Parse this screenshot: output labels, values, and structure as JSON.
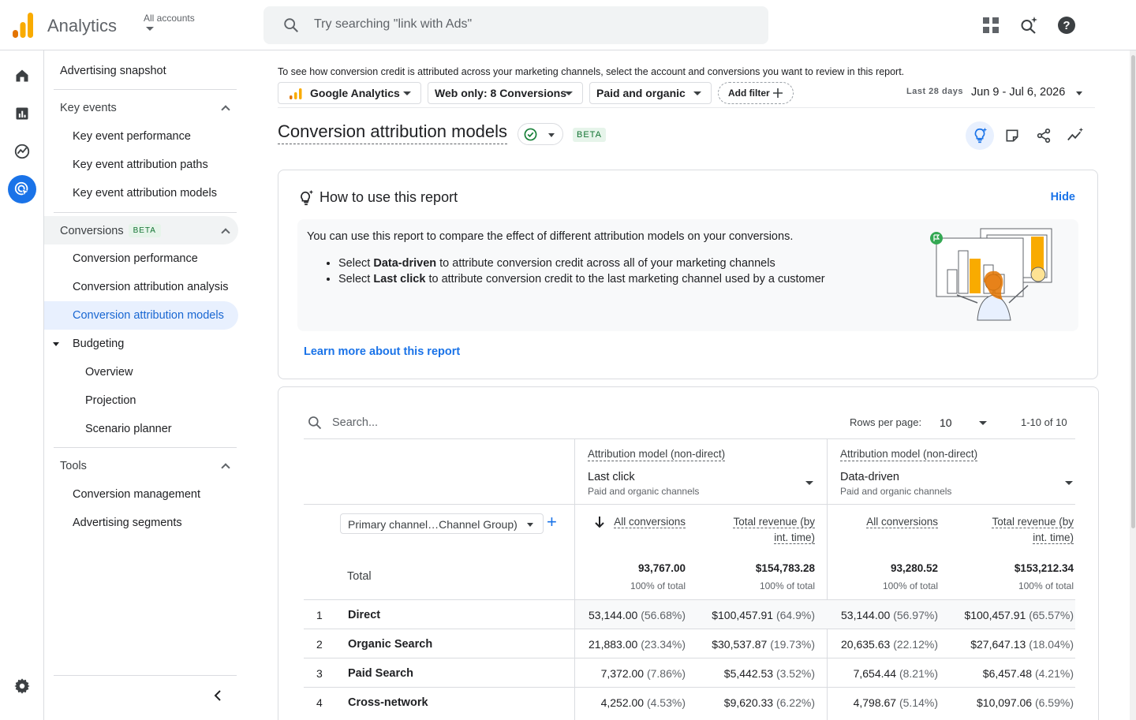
{
  "app": {
    "title": "Analytics",
    "account_label": "All accounts",
    "search_placeholder": "Try searching \"link with Ads\""
  },
  "sidebar": {
    "advertising_snapshot": "Advertising snapshot",
    "key_events": {
      "label": "Key events",
      "items": [
        "Key event performance",
        "Key event attribution paths",
        "Key event attribution models"
      ]
    },
    "conversions": {
      "label": "Conversions",
      "badge": "BETA",
      "items": [
        "Conversion performance",
        "Conversion attribution analysis",
        "Conversion attribution models"
      ]
    },
    "budgeting": {
      "label": "Budgeting",
      "items": [
        "Overview",
        "Projection",
        "Scenario planner"
      ]
    },
    "tools": {
      "label": "Tools",
      "items": [
        "Conversion management",
        "Advertising segments"
      ]
    }
  },
  "main": {
    "info_text": "To see how conversion credit is attributed across your marketing channels, select the account and conversions you want to review in this report.",
    "filters": {
      "property": "Google Analytics",
      "conversions": "Web only: 8 Conversions",
      "channels": "Paid and organic",
      "add_filter": "Add filter"
    },
    "date_range": {
      "label": "Last 28 days",
      "value": "Jun 9 - Jul 6, 2026"
    },
    "page_title": "Conversion attribution models",
    "beta": "BETA"
  },
  "howto": {
    "title": "How to use this report",
    "hide": "Hide",
    "description": "You can use this report to compare the effect of different attribution models on your conversions.",
    "bullets": [
      {
        "pre": "Select ",
        "bold": "Data-driven",
        "post": " to attribute conversion credit across all of your marketing channels"
      },
      {
        "pre": "Select ",
        "bold": "Last click",
        "post": " to attribute conversion credit to the last marketing channel used by a customer"
      }
    ],
    "learn_more": "Learn more about this report"
  },
  "table": {
    "search_placeholder": "Search...",
    "rows_per_page_label": "Rows per page:",
    "rows_per_page": "10",
    "pagination": "1-10 of 10",
    "dimension": "Primary channel…Channel Group)",
    "models": [
      {
        "label": "Attribution model (non-direct)",
        "name": "Last click",
        "sub": "Paid and organic channels"
      },
      {
        "label": "Attribution model (non-direct)",
        "name": "Data-driven",
        "sub": "Paid and organic channels"
      }
    ],
    "col_all_conversions": "All conversions",
    "col_revenue_1": "Total revenue (by",
    "col_revenue_2": "int. time)",
    "total_label": "Total",
    "totals": [
      {
        "value": "93,767.00",
        "pct": "100% of total"
      },
      {
        "value": "$154,783.28",
        "pct": "100% of total"
      },
      {
        "value": "93,280.52",
        "pct": "100% of total"
      },
      {
        "value": "$153,212.34",
        "pct": "100% of total"
      }
    ],
    "rows": [
      {
        "idx": "1",
        "channel": "Direct",
        "c1": "53,144.00",
        "p1": "(56.68%)",
        "c2": "$100,457.91",
        "p2": "(64.9%)",
        "c3": "53,144.00",
        "p3": "(56.97%)",
        "c4": "$100,457.91",
        "p4": "(65.57%)"
      },
      {
        "idx": "2",
        "channel": "Organic Search",
        "c1": "21,883.00",
        "p1": "(23.34%)",
        "c2": "$30,537.87",
        "p2": "(19.73%)",
        "c3": "20,635.63",
        "p3": "(22.12%)",
        "c4": "$27,647.13",
        "p4": "(18.04%)"
      },
      {
        "idx": "3",
        "channel": "Paid Search",
        "c1": "7,372.00",
        "p1": "(7.86%)",
        "c2": "$5,442.53",
        "p2": "(3.52%)",
        "c3": "7,654.44",
        "p3": "(8.21%)",
        "c4": "$6,457.48",
        "p4": "(4.21%)"
      },
      {
        "idx": "4",
        "channel": "Cross-network",
        "c1": "4,252.00",
        "p1": "(4.53%)",
        "c2": "$9,620.33",
        "p2": "(6.22%)",
        "c3": "4,798.67",
        "p3": "(5.14%)",
        "c4": "$10,097.06",
        "p4": "(6.59%)"
      }
    ]
  },
  "colors": {
    "accent": "#1a73e8",
    "selected_bg": "#e8f0fe",
    "logo_orange": "#f9ab00",
    "logo_dark": "#e37400"
  }
}
